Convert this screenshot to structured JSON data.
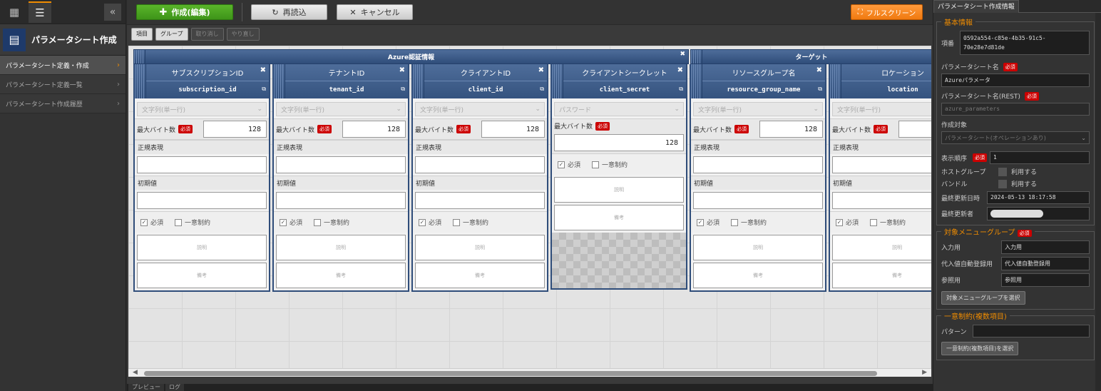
{
  "sidebar": {
    "title": "パラメータシート作成",
    "items": [
      {
        "label": "パラメータシート定義・作成",
        "active": true
      },
      {
        "label": "パラメータシート定義一覧",
        "active": false
      },
      {
        "label": "パラメータシート作成履歴",
        "active": false
      }
    ]
  },
  "toolbar": {
    "create_label": "作成(編集)",
    "reload_label": "再読込",
    "cancel_label": "キャンセル",
    "fullscreen_label": "フルスクリーン"
  },
  "subtoolbar": {
    "item_label": "項目",
    "group_label": "グループ",
    "undo_label": "取り消し",
    "redo_label": "やり直し"
  },
  "groups": [
    {
      "name": "Azure認証情報"
    },
    {
      "name": "ターゲット"
    }
  ],
  "columns": [
    {
      "name": "サブスクリプションID",
      "rest": "subscription_id",
      "type": "文字列(単一行)",
      "max_bytes": "128"
    },
    {
      "name": "テナントID",
      "rest": "tenant_id",
      "type": "文字列(単一行)",
      "max_bytes": "128"
    },
    {
      "name": "クライアントID",
      "rest": "client_id",
      "type": "文字列(単一行)",
      "max_bytes": "128"
    },
    {
      "name": "クライアントシークレット",
      "rest": "client_secret",
      "type": "パスワード",
      "max_bytes": "128"
    },
    {
      "name": "リソースグループ名",
      "rest": "resource_group_name",
      "type": "文字列(単一行)",
      "max_bytes": "128"
    },
    {
      "name": "ロケーション",
      "rest": "location",
      "type": "文字列(単一行)",
      "max_bytes": ""
    }
  ],
  "column_labels": {
    "max_bytes": "最大バイト数",
    "required_badge": "必須",
    "regex": "正規表現",
    "default": "初期値",
    "required": "必須",
    "unique": "一意制約",
    "description": "説明",
    "note": "備考"
  },
  "bottom_tabs": [
    "プレビュー",
    "ログ"
  ],
  "right_panel": {
    "tab": "パラメータシート作成情報",
    "basic": {
      "title": "基本情報",
      "item_label": "項番",
      "item_value": "0592a554-c85e-4b35-91c5-70e28e7d81de",
      "name_label": "パラメータシート名",
      "name_value": "Azureパラメータ",
      "rest_label": "パラメータシート名(REST)",
      "rest_value": "azure_parameters",
      "target_label": "作成対象",
      "target_value": "パラメータシート(オペレーションあり)",
      "order_label": "表示順序",
      "order_value": "1",
      "hostgroup_label": "ホストグループ",
      "hostgroup_value": "利用する",
      "bundle_label": "バンドル",
      "bundle_value": "利用する",
      "updated_label": "最終更新日時",
      "updated_value": "2024-05-13 18:17:58",
      "updater_label": "最終更新者",
      "required_badge": "必須"
    },
    "menu_group": {
      "title": "対象メニューグループ",
      "required_badge": "必須",
      "input_label": "入力用",
      "input_value": "入力用",
      "sub_label": "代入値自動登録用",
      "sub_value": "代入値自動登録用",
      "ref_label": "参照用",
      "ref_value": "参照用",
      "select_button": "対象メニューグループを選択"
    },
    "unique": {
      "title": "一意制約(複数項目)",
      "pattern_label": "パターン",
      "select_button": "一意制約(複数項目)を選択"
    }
  }
}
